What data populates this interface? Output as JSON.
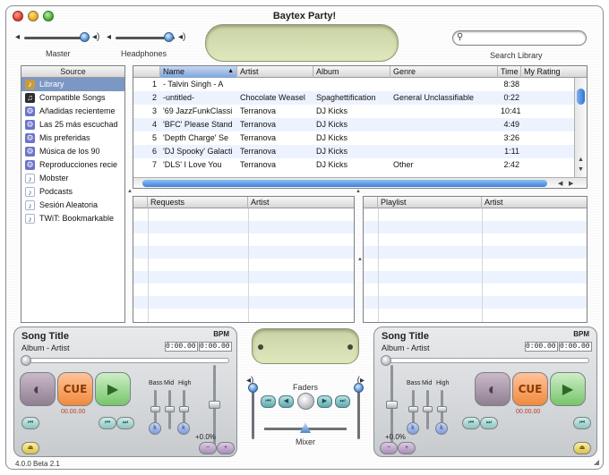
{
  "window": {
    "title": "Baytex Party!",
    "version": "4.0.0 Beta 2.1"
  },
  "toolbar": {
    "master_label": "Master",
    "headphones_label": "Headphones",
    "search_placeholder": "",
    "search_label": "Search Library"
  },
  "source": {
    "header": "Source",
    "items": [
      {
        "label": "Library",
        "icon": "library-icon",
        "selected": true
      },
      {
        "label": "Compatible Songs",
        "icon": "compatible-icon"
      },
      {
        "label": "Añadidas recienteme",
        "icon": "smart-playlist-icon"
      },
      {
        "label": "Las 25 más escuchad",
        "icon": "smart-playlist-icon"
      },
      {
        "label": "Mis preferidas",
        "icon": "smart-playlist-icon"
      },
      {
        "label": "Música de los 90",
        "icon": "smart-playlist-icon"
      },
      {
        "label": "Reproducciones recie",
        "icon": "smart-playlist-icon"
      },
      {
        "label": "Mobster",
        "icon": "playlist-icon"
      },
      {
        "label": "Podcasts",
        "icon": "playlist-icon"
      },
      {
        "label": "Sesión Aleatoria",
        "icon": "playlist-icon"
      },
      {
        "label": "TWiT: Bookmarkable",
        "icon": "playlist-icon"
      }
    ]
  },
  "library": {
    "columns": [
      "",
      "Name",
      "Artist",
      "Album",
      "Genre",
      "Time",
      "My Rating"
    ],
    "rows": [
      {
        "num": "1",
        "name": "- Talvin Singh - A",
        "artist": "",
        "album": "",
        "genre": "",
        "time": "8:38"
      },
      {
        "num": "2",
        "name": "-untitled-",
        "artist": "Chocolate Weasel",
        "album": "Spaghettification",
        "genre": "General Unclassifiable",
        "time": "0:22"
      },
      {
        "num": "3",
        "name": "'69 JazzFunkClassi",
        "artist": "Terranova",
        "album": "DJ Kicks",
        "genre": "",
        "time": "10:41"
      },
      {
        "num": "4",
        "name": "'BFC' Please Stand",
        "artist": "Terranova",
        "album": "DJ Kicks",
        "genre": "",
        "time": "4:49"
      },
      {
        "num": "5",
        "name": "'Depth Charge' Se",
        "artist": "Terranova",
        "album": "DJ Kicks",
        "genre": "",
        "time": "3:26"
      },
      {
        "num": "6",
        "name": "'DJ Spooky' Galacti",
        "artist": "Terranova",
        "album": "DJ Kicks",
        "genre": "",
        "time": "1:11"
      },
      {
        "num": "7",
        "name": "'DLS' I Love You",
        "artist": "Terranova",
        "album": "DJ Kicks",
        "genre": "Other",
        "time": "2:42"
      }
    ]
  },
  "requests": {
    "columns": [
      "Requests",
      "Artist"
    ]
  },
  "playlist": {
    "columns": [
      "Playlist",
      "Artist"
    ]
  },
  "deck_left": {
    "song_title": "Song Title",
    "album_artist": "Album - Artist",
    "bpm_label": "BPM",
    "time_a": "0:00.00",
    "time_b": "0:00.00",
    "cue_label": "CUE",
    "cue_time": "00.00.00",
    "eq_bass": "Bass",
    "eq_mid": "Mid",
    "eq_high": "High",
    "pitch_pct": "+0.0%"
  },
  "deck_right": {
    "song_title": "Song Title",
    "album_artist": "Album - Artist",
    "bpm_label": "BPM",
    "time_a": "0:00.00",
    "time_b": "0:00.00",
    "cue_label": "CUE",
    "cue_time": "00.00.00",
    "eq_bass": "Bass",
    "eq_mid": "Mid",
    "eq_high": "High",
    "pitch_pct": "+0.0%"
  },
  "mixer": {
    "faders_label": "Faders",
    "mixer_label": "Mixer"
  },
  "colors": {
    "accent": "#7b97c3",
    "row_alt": "#edf3fe",
    "lcd": "#d6dfb2"
  }
}
